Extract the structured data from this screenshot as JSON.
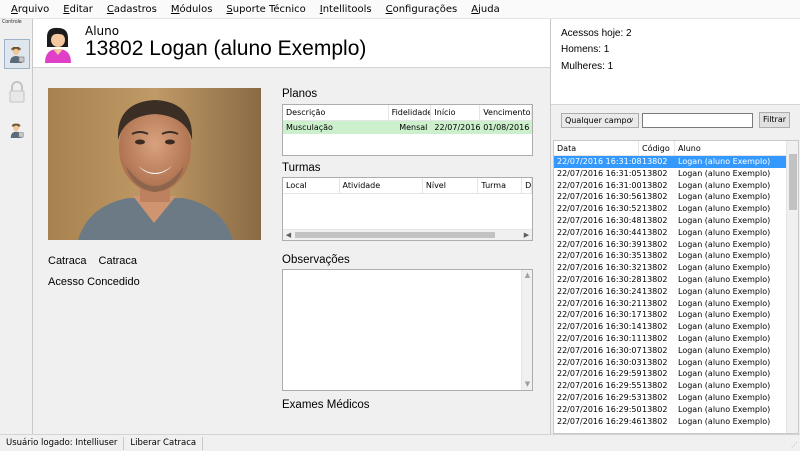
{
  "menu": [
    "Arquivo",
    "Editar",
    "Cadastros",
    "Módulos",
    "Suporte Técnico",
    "Intellitools",
    "Configurações",
    "Ajuda"
  ],
  "menu_access_keys": [
    "A",
    "E",
    "C",
    "M",
    "S",
    "I",
    "C",
    "A"
  ],
  "toolbar": {
    "caption": "Controle"
  },
  "aluno": {
    "label": "Aluno",
    "title": "13802 Logan (aluno Exemplo)"
  },
  "catraca": {
    "label1": "Catraca",
    "label2": "Catraca",
    "status": "Acesso Concedido"
  },
  "planos": {
    "label": "Planos",
    "columns": [
      "Descrição",
      "Fidelidade",
      "Início",
      "Vencimento"
    ],
    "rows": [
      [
        "Musculação",
        "Mensal",
        "22/07/2016",
        "01/08/2016"
      ]
    ]
  },
  "turmas": {
    "label": "Turmas",
    "columns": [
      "Local",
      "Atividade",
      "Nível",
      "Turma",
      "D"
    ]
  },
  "observacoes": {
    "label": "Observações"
  },
  "exames": {
    "label": "Exames Médicos"
  },
  "stats": {
    "acessos_hoje": "Acessos hoje: 2",
    "homens": "Homens: 1",
    "mulheres": "Mulheres: 1"
  },
  "filter": {
    "field": "Qualquer campo",
    "value": "",
    "button": "Filtrar"
  },
  "access_list": {
    "columns": [
      "Data",
      "Código",
      "Aluno"
    ],
    "rows": [
      [
        "22/07/2016 16:31:08",
        "13802",
        "Logan (aluno Exemplo)"
      ],
      [
        "22/07/2016 16:31:05",
        "13802",
        "Logan (aluno Exemplo)"
      ],
      [
        "22/07/2016 16:31:00",
        "13802",
        "Logan (aluno Exemplo)"
      ],
      [
        "22/07/2016 16:30:56",
        "13802",
        "Logan (aluno Exemplo)"
      ],
      [
        "22/07/2016 16:30:52",
        "13802",
        "Logan (aluno Exemplo)"
      ],
      [
        "22/07/2016 16:30:48",
        "13802",
        "Logan (aluno Exemplo)"
      ],
      [
        "22/07/2016 16:30:44",
        "13802",
        "Logan (aluno Exemplo)"
      ],
      [
        "22/07/2016 16:30:39",
        "13802",
        "Logan (aluno Exemplo)"
      ],
      [
        "22/07/2016 16:30:35",
        "13802",
        "Logan (aluno Exemplo)"
      ],
      [
        "22/07/2016 16:30:32",
        "13802",
        "Logan (aluno Exemplo)"
      ],
      [
        "22/07/2016 16:30:28",
        "13802",
        "Logan (aluno Exemplo)"
      ],
      [
        "22/07/2016 16:30:24",
        "13802",
        "Logan (aluno Exemplo)"
      ],
      [
        "22/07/2016 16:30:21",
        "13802",
        "Logan (aluno Exemplo)"
      ],
      [
        "22/07/2016 16:30:17",
        "13802",
        "Logan (aluno Exemplo)"
      ],
      [
        "22/07/2016 16:30:14",
        "13802",
        "Logan (aluno Exemplo)"
      ],
      [
        "22/07/2016 16:30:11",
        "13802",
        "Logan (aluno Exemplo)"
      ],
      [
        "22/07/2016 16:30:07",
        "13802",
        "Logan (aluno Exemplo)"
      ],
      [
        "22/07/2016 16:30:03",
        "13802",
        "Logan (aluno Exemplo)"
      ],
      [
        "22/07/2016 16:29:59",
        "13802",
        "Logan (aluno Exemplo)"
      ],
      [
        "22/07/2016 16:29:55",
        "13802",
        "Logan (aluno Exemplo)"
      ],
      [
        "22/07/2016 16:29:53",
        "13802",
        "Logan (aluno Exemplo)"
      ],
      [
        "22/07/2016 16:29:50",
        "13802",
        "Logan (aluno Exemplo)"
      ],
      [
        "22/07/2016 16:29:46",
        "13802",
        "Logan (aluno Exemplo)"
      ]
    ]
  },
  "status": {
    "user": "Usuário logado: Intelliuser",
    "action": "Liberar Catraca"
  },
  "colors": {
    "selection": "#3399ff",
    "plan_row": "#ccf0cc",
    "avatar_pink": "#e040c8"
  },
  "icons": [
    "user-icon",
    "lock-icon",
    "user-small-icon",
    "student-avatar-icon",
    "scroll-left-icon",
    "scroll-right-icon",
    "scroll-up-icon",
    "scroll-down-icon",
    "dropdown-chevron-icon",
    "resize-grip-icon"
  ]
}
